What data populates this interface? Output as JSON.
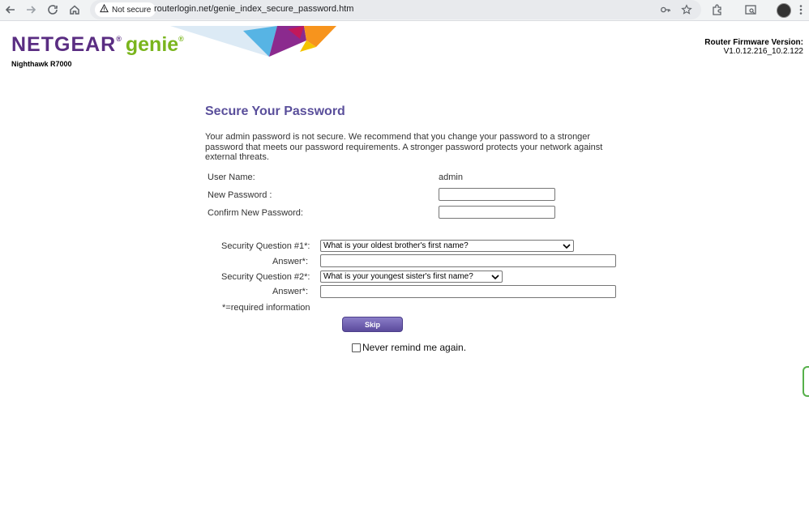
{
  "browser": {
    "security_label": "Not secure",
    "url": "routerlogin.net/genie_index_secure_password.htm",
    "icons": [
      "back-icon",
      "forward-icon",
      "reload-icon",
      "home-icon",
      "warning-icon",
      "password-key-icon",
      "star-icon",
      "extensions-icon",
      "tab-search-icon",
      "profile-avatar"
    ]
  },
  "header": {
    "brand": "NETGEAR",
    "brand_mark": "®",
    "product": "genie",
    "product_mark": "®",
    "model": "Nighthawk R7000",
    "firmware_label": "Router Firmware Version:",
    "firmware_value": "V1.0.12.216_10.2.122"
  },
  "form": {
    "title": "Secure Your Password",
    "intro": "Your admin password is not secure. We recommend that you change your password to a stronger password that meets our password requirements. A stronger password protects your network against external threats.",
    "username_label": "User Name:",
    "username_value": "admin",
    "new_password_label": "New Password :",
    "confirm_password_label": "Confirm New Password:",
    "question1_label": "Security Question #1*:",
    "question1_value": "What is your oldest brother's first name?",
    "answer1_label": "Answer*:",
    "question2_label": "Security Question #2*:",
    "question2_value": "What is your youngest sister's first name?",
    "answer2_label": "Answer*:",
    "required_note": "*=required information",
    "skip_label": "Skip",
    "never_remind_label": "Never remind me again."
  },
  "colors": {
    "title": "#5a4f9b",
    "brand": "#5a2d82",
    "genie": "#7ab51d",
    "skip_button": "#6a5cb0"
  }
}
